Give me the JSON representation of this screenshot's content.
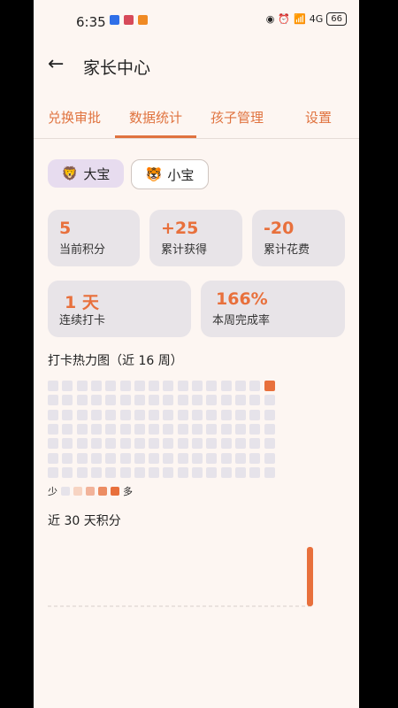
{
  "status": {
    "time": "6:35",
    "battery": "66",
    "network": "4G"
  },
  "header": {
    "title": "家长中心",
    "back": "←"
  },
  "tabs": [
    {
      "label": "兑换审批"
    },
    {
      "label": "数据统计"
    },
    {
      "label": "孩子管理"
    },
    {
      "label": "设置"
    }
  ],
  "active_tab": 1,
  "children": [
    {
      "emoji": "🦁",
      "name": "大宝"
    },
    {
      "emoji": "🐯",
      "name": "小宝"
    }
  ],
  "stats": {
    "current_points": {
      "value": "5",
      "label": "当前积分"
    },
    "total_earned": {
      "value": "+25",
      "label": "累计获得"
    },
    "total_spent": {
      "value": "-20",
      "label": "累计花费"
    },
    "streak": {
      "value": "1 天",
      "label": "连续打卡"
    },
    "week_rate": {
      "value": "166%",
      "label": "本周完成率"
    }
  },
  "heatmap": {
    "title": "打卡热力图（近 16 周）",
    "legend_low": "少",
    "legend_high": "多",
    "weeks": 16,
    "days": 7,
    "active": [
      {
        "week": 15,
        "day": 0,
        "level": 4
      }
    ],
    "colors": [
      "#e6e3ea",
      "#f7d4c2",
      "#f2b39a",
      "#ec8d63",
      "#e8703c"
    ]
  },
  "chart_data": {
    "type": "bar",
    "title": "近 30 天积分",
    "values": [
      0,
      0,
      0,
      0,
      0,
      0,
      0,
      0,
      0,
      0,
      0,
      0,
      0,
      0,
      0,
      0,
      0,
      0,
      0,
      0,
      0,
      0,
      0,
      0,
      0,
      0,
      0,
      0,
      0,
      5
    ],
    "ylim": [
      0,
      5
    ],
    "color": "#e8703c"
  }
}
